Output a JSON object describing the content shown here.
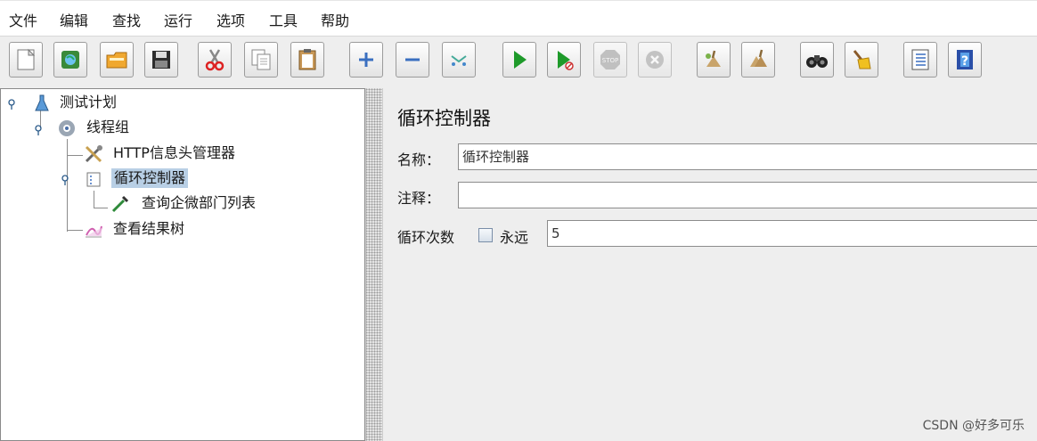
{
  "menu": [
    "文件",
    "编辑",
    "查找",
    "运行",
    "选项",
    "工具",
    "帮助"
  ],
  "toolbar": [
    {
      "icon": "new-icon"
    },
    {
      "icon": "templates-icon"
    },
    {
      "icon": "open-icon"
    },
    {
      "icon": "save-icon"
    },
    {
      "icon": "cut-icon"
    },
    {
      "icon": "copy-icon"
    },
    {
      "icon": "paste-icon"
    },
    {
      "icon": "expand-icon"
    },
    {
      "icon": "collapse-icon"
    },
    {
      "icon": "toggle-icon"
    },
    {
      "icon": "start-icon"
    },
    {
      "icon": "start-no-timers-icon"
    },
    {
      "icon": "stop-icon"
    },
    {
      "icon": "shutdown-icon"
    },
    {
      "icon": "clear-icon"
    },
    {
      "icon": "clear-all-icon"
    },
    {
      "icon": "search-icon"
    },
    {
      "icon": "reset-search-icon"
    },
    {
      "icon": "function-helper-icon"
    },
    {
      "icon": "help-icon"
    }
  ],
  "tree": [
    {
      "label": "测试计划",
      "icon": "test-plan-icon",
      "selected": false
    },
    {
      "label": "线程组",
      "icon": "thread-group-icon",
      "selected": false
    },
    {
      "label": "HTTP信息头管理器",
      "icon": "header-manager-icon",
      "selected": false
    },
    {
      "label": "循环控制器",
      "icon": "loop-controller-icon",
      "selected": true
    },
    {
      "label": "查询企微部门列表",
      "icon": "http-sampler-icon",
      "selected": false
    },
    {
      "label": "查看结果树",
      "icon": "results-tree-icon",
      "selected": false
    }
  ],
  "detail": {
    "title": "循环控制器",
    "name_label": "名称：",
    "name_value": "循环控制器",
    "comment_label": "注释：",
    "comment_value": "",
    "loop_label": "循环次数",
    "forever_label": "永远",
    "forever_checked": false,
    "loop_value": "5"
  },
  "watermark": "CSDN @好多可乐"
}
